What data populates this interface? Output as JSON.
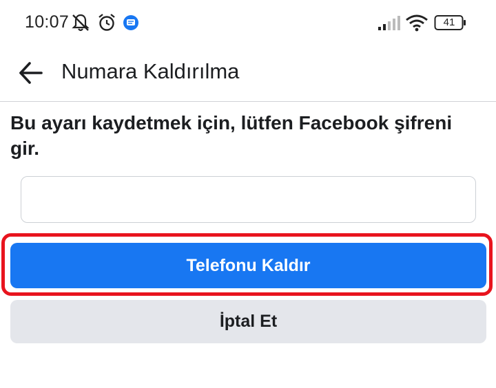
{
  "status_bar": {
    "time": "10:07",
    "battery_level": "41",
    "left_icons": [
      "muted-notifications-icon",
      "alarm-clock-icon",
      "messages-icon"
    ],
    "right_icons": [
      "signal-strength-icon",
      "wifi-icon",
      "battery-icon"
    ]
  },
  "header": {
    "back_icon": "arrow-left-icon",
    "title": "Numara Kaldırılma"
  },
  "main": {
    "prompt": "Bu ayarı kaydetmek için, lütfen Facebook şifreni gir.",
    "password_value": "",
    "primary_button_label": "Telefonu Kaldır",
    "secondary_button_label": "İptal Et"
  },
  "colors": {
    "primary": "#1877f2",
    "secondary_bg": "#e4e6eb",
    "highlight_border": "#e8141e",
    "messages_icon": "#1877f2"
  }
}
